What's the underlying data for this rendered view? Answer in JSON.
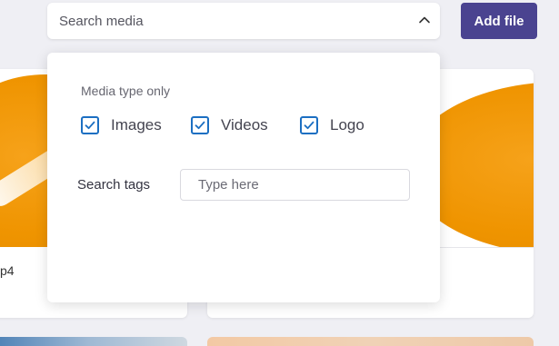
{
  "header": {
    "search_label": "Search media",
    "add_file_label": "Add file"
  },
  "filter_panel": {
    "heading": "Media type only",
    "media_types": [
      {
        "label": "Images",
        "checked": true
      },
      {
        "label": "Videos",
        "checked": true
      },
      {
        "label": "Logo",
        "checked": true
      }
    ],
    "tags_label": "Search tags",
    "tags_placeholder": "Type here"
  },
  "cards": [
    {
      "caption_fragment": "p4"
    },
    {
      "caption_fragment": ""
    }
  ],
  "colors": {
    "accent": "#4a4390",
    "checkbox": "#1c6fc2",
    "thumbnail": "#ef9400",
    "background": "#efeff4"
  },
  "icons": {
    "search_toggle": "chevron-up-icon",
    "checkbox": "checkmark-icon"
  }
}
